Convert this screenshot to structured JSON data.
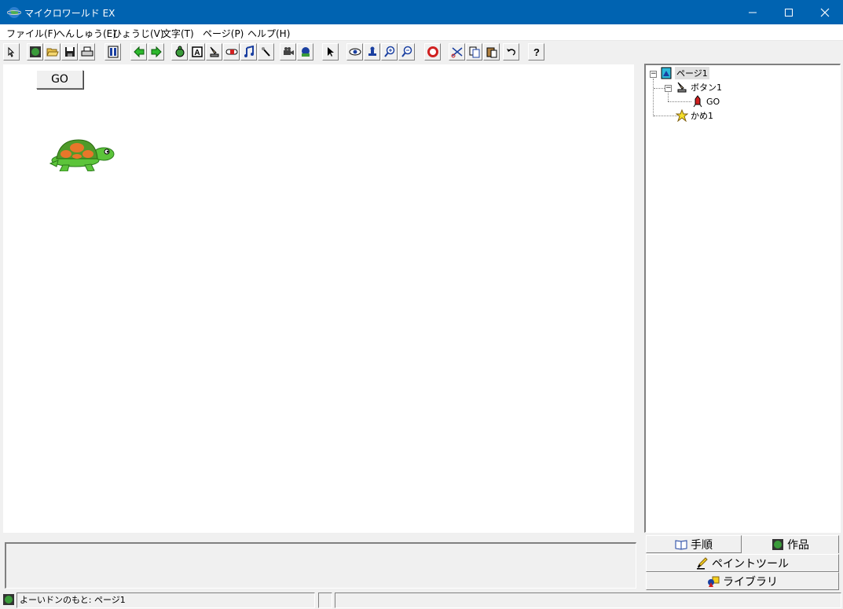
{
  "window": {
    "title": "マイクロワールド EX"
  },
  "menu": [
    "ファイル(F)",
    "へんしゅう(E)",
    "ひょうじ(V)",
    "文字(T)",
    "ページ(P)",
    "ヘルプ(H)"
  ],
  "page_canvas": {
    "button_label": "GO"
  },
  "tree": {
    "page": "ページ1",
    "button": "ボタン1",
    "button_instruction": "GO",
    "turtle": "かめ1"
  },
  "panel_tabs": {
    "steps": "手順",
    "project": "作品",
    "paint": "ペイントツール",
    "library": "ライブラリ"
  },
  "status": {
    "text": "よーいドンのもと: ページ1"
  },
  "colors": {
    "titlebar": "#0063b1",
    "turtle_shell": "#e8762a",
    "turtle_body": "#5cc43a"
  }
}
